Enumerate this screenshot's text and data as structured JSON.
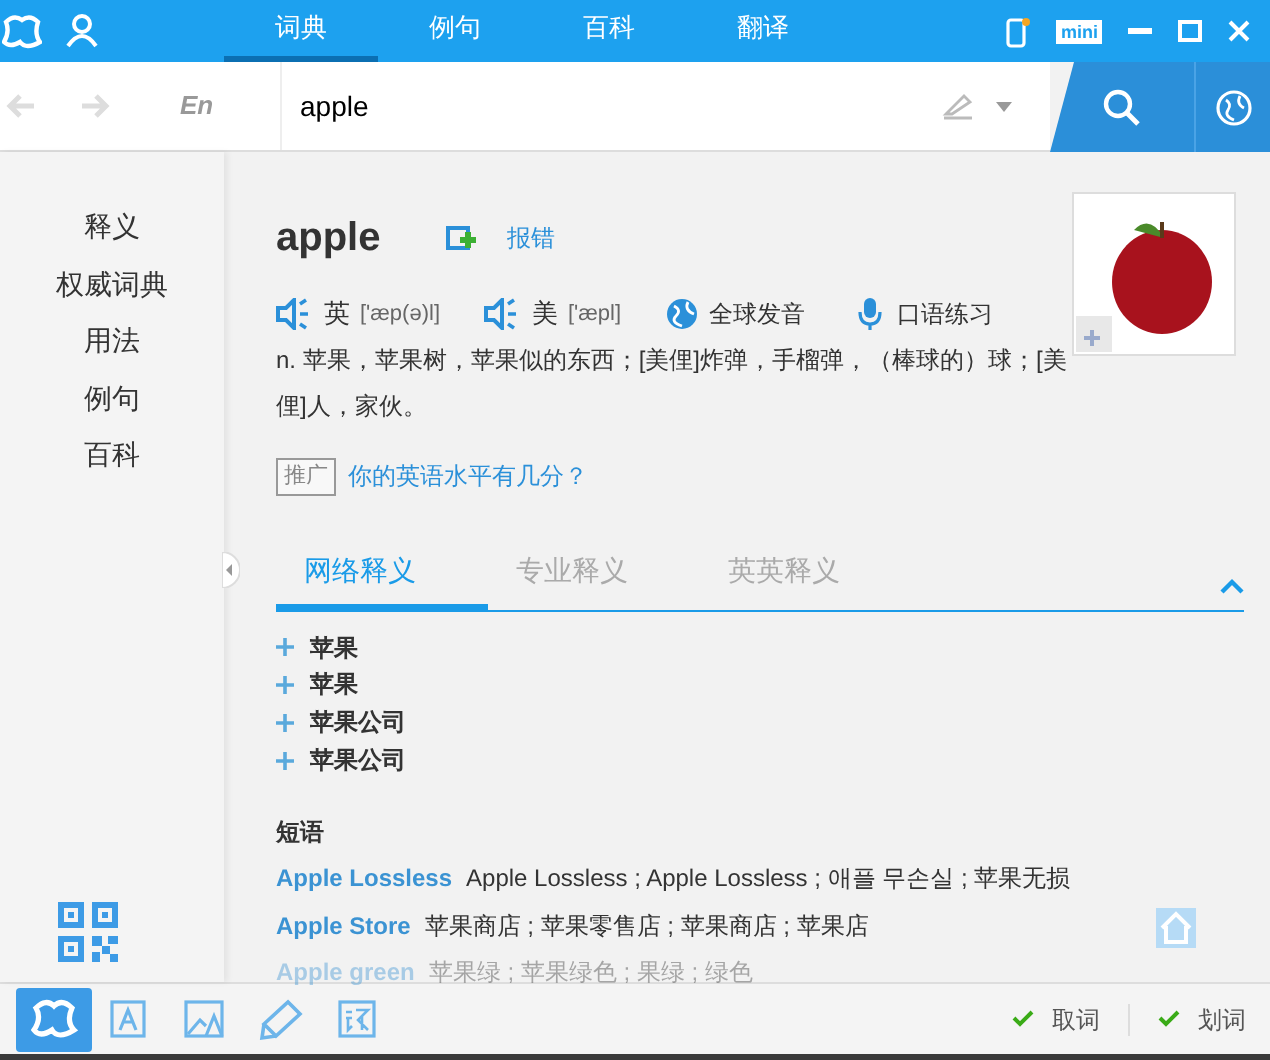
{
  "top_tabs": [
    {
      "label": "词典",
      "selected": true
    },
    {
      "label": "例句",
      "selected": false
    },
    {
      "label": "百科",
      "selected": false
    },
    {
      "label": "翻译",
      "selected": false
    }
  ],
  "window_controls": {
    "mini_label": "mini"
  },
  "search": {
    "language": "En",
    "value": "apple"
  },
  "sidebar": {
    "items": [
      "释义",
      "权威词典",
      "用法",
      "例句",
      "百科"
    ]
  },
  "entry": {
    "word": "apple",
    "report_link": "报错",
    "pronunciations": [
      {
        "kind": "speaker",
        "region": "英",
        "phonetic": "['æp(ə)l]"
      },
      {
        "kind": "speaker",
        "region": "美",
        "phonetic": "['æpl]"
      },
      {
        "kind": "globe",
        "label": "全球发音"
      },
      {
        "kind": "mic",
        "label": "口语练习"
      }
    ],
    "definition": "n. 苹果，苹果树，苹果似的东西；[美俚]炸弹，手榴弹，（棒球的）球；[美俚]人，家伙。",
    "promo": {
      "tag": "推广",
      "link": "你的英语水平有几分？"
    }
  },
  "meaning_tabs": [
    {
      "label": "网络释义",
      "selected": true
    },
    {
      "label": "专业释义",
      "selected": false
    },
    {
      "label": "英英释义",
      "selected": false
    }
  ],
  "web_meanings": [
    "苹果",
    "苹果",
    "苹果公司",
    "苹果公司"
  ],
  "phrases": {
    "title": "短语",
    "items": [
      {
        "term": "Apple Lossless",
        "meaning": "Apple Lossless ; Apple Lossless ; 애플 무손실 ; 苹果无损"
      },
      {
        "term": "Apple Store",
        "meaning": "苹果商店 ; 苹果零售店 ; 苹果商店 ; 苹果店"
      },
      {
        "term": "Apple green",
        "meaning": "苹果绿 ; 苹果绿色 ; 果绿 ; 绿色"
      }
    ]
  },
  "bottom_tools": [
    {
      "kind": "logo",
      "selected": true
    },
    {
      "kind": "text",
      "selected": false
    },
    {
      "kind": "image",
      "selected": false
    },
    {
      "kind": "pen",
      "selected": false
    },
    {
      "kind": "translate",
      "selected": false
    }
  ],
  "bottom_toggles": [
    {
      "label": "取词",
      "checked": true
    },
    {
      "label": "划词",
      "checked": true
    }
  ]
}
